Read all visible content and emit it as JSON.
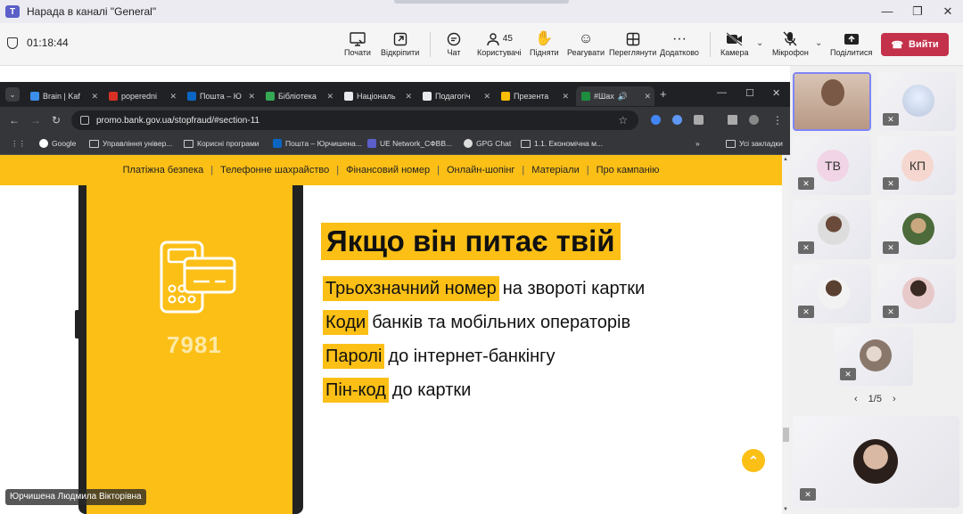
{
  "window": {
    "title": "Нарада в каналі \"General\""
  },
  "meeting": {
    "timer": "01:18:44",
    "toolbar": {
      "start": "Почати",
      "open": "Відкріпити",
      "chat": "Чат",
      "people": "Користувачі",
      "people_count": "45",
      "raise": "Підняти",
      "react": "Реагувати",
      "view": "Переглянути",
      "more": "Додатково",
      "camera": "Камера",
      "mic": "Мікрофон",
      "share": "Поділитися",
      "leave": "Вийти"
    },
    "presenter": "Юрчишена Людмила Вікторівна",
    "participants": [
      {
        "initials": "ТВ"
      },
      {
        "initials": "КП"
      }
    ],
    "pager": "1/5"
  },
  "browser": {
    "tabs": [
      "Brain | Kaf",
      "poperedni",
      "Пошта – Ю",
      "Бібліотека",
      "Національ",
      "Подагогіч",
      "Презента",
      "#Шах"
    ],
    "url": "promo.bank.gov.ua/stopfraud/#section-11",
    "bookmarks": [
      "Google",
      "Управління універ...",
      "Корисні програми",
      "Пошта – Юрчишена...",
      "UE Network_СФВВ...",
      "GPG Chat",
      "1.1. Економічна м..."
    ],
    "all_bookmarks": "Усі закладки"
  },
  "site": {
    "nav": [
      "Платіжна безпека",
      "Телефонне шахрайство",
      "Фінансовий номер",
      "Онлайн-шопінг",
      "Матеріали",
      "Про кампанію"
    ],
    "card_number": "7981",
    "heading": "Якщо він питає твій",
    "items": [
      {
        "highlight": "Трьохзначний номер",
        "rest": "на звороті картки"
      },
      {
        "highlight": "Коди",
        "rest": "банків та мобільних операторів"
      },
      {
        "highlight": "Паролі",
        "rest": "до інтернет-банкінгу"
      },
      {
        "highlight": "Пін-код",
        "rest": "до картки"
      }
    ]
  },
  "colors": {
    "accent_yellow": "#fbbf16",
    "leave_red": "#c4314b",
    "teams_purple": "#5b5fc7"
  }
}
